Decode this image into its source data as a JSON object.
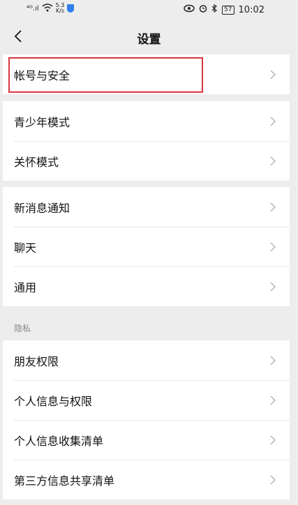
{
  "status_bar": {
    "signal": "⁴ᴳ.ıl",
    "speed": "5.3\nK/s",
    "battery": "57",
    "time": "10:02"
  },
  "header": {
    "title": "设置"
  },
  "groups": [
    {
      "items": [
        {
          "label": "帐号与安全"
        }
      ]
    },
    {
      "items": [
        {
          "label": "青少年模式"
        },
        {
          "label": "关怀模式"
        }
      ]
    },
    {
      "items": [
        {
          "label": "新消息通知"
        },
        {
          "label": "聊天"
        },
        {
          "label": "通用"
        }
      ]
    },
    {
      "title": "隐私",
      "items": [
        {
          "label": "朋友权限"
        },
        {
          "label": "个人信息与权限"
        },
        {
          "label": "个人信息收集清单"
        },
        {
          "label": "第三方信息共享清单"
        }
      ]
    }
  ],
  "colors": {
    "highlight": "#d9363e",
    "background": "#ededed"
  }
}
